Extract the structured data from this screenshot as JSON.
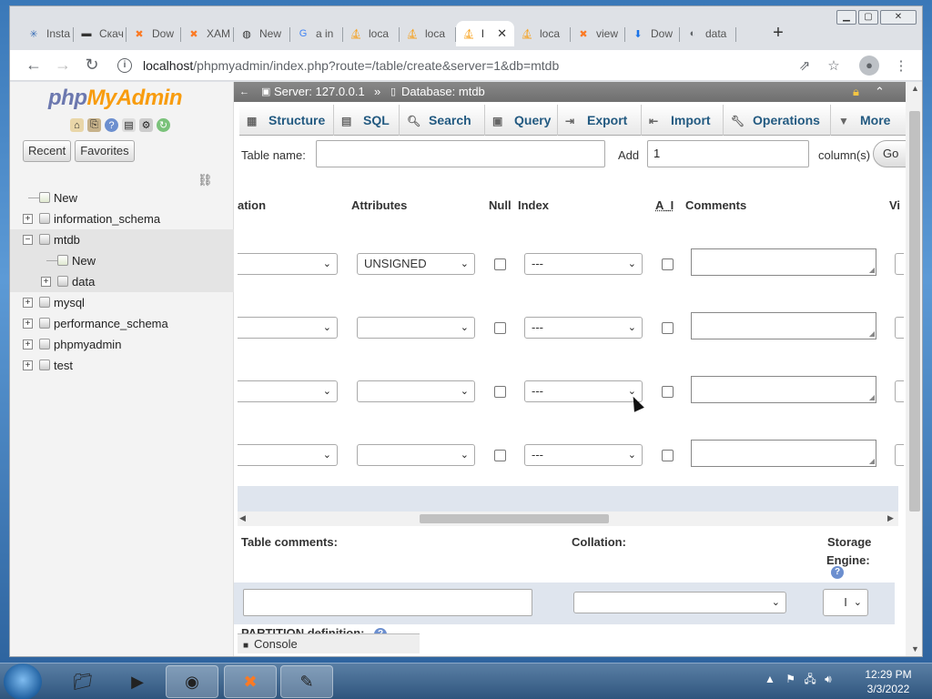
{
  "browser": {
    "tabs": [
      {
        "label": "Insta",
        "icon": "instagram-icon",
        "icon_color": "#3b6fb6"
      },
      {
        "label": "Скач",
        "icon": "terminal-icon",
        "icon_color": "#333333"
      },
      {
        "label": "Dow",
        "icon": "xampp-icon",
        "icon_color": "#fb7a24"
      },
      {
        "label": "XAM",
        "icon": "xampp-icon",
        "icon_color": "#fb7a24"
      },
      {
        "label": "New",
        "icon": "github-icon",
        "icon_color": "#333333"
      },
      {
        "label": "a in",
        "icon": "google-icon",
        "icon_color": "#4285f4"
      },
      {
        "label": "loca",
        "icon": "phpmyadmin-icon",
        "icon_color": "#f89c0e"
      },
      {
        "label": "loca",
        "icon": "phpmyadmin-icon",
        "icon_color": "#f89c0e"
      },
      {
        "label": "l",
        "icon": "phpmyadmin-icon",
        "icon_color": "#f89c0e",
        "active": true
      },
      {
        "label": "loca",
        "icon": "phpmyadmin-icon",
        "icon_color": "#f89c0e"
      },
      {
        "label": "view",
        "icon": "xampp-icon",
        "icon_color": "#fb7a24"
      },
      {
        "label": "Dow",
        "icon": "download-icon",
        "icon_color": "#1a73e8"
      },
      {
        "label": "data",
        "icon": "globe-icon",
        "icon_color": "#5f6368"
      }
    ],
    "new_tab": "+",
    "url_host": "localhost",
    "url_path": "/phpmyadmin/index.php?route=/table/create&server=1&db=mtdb"
  },
  "sidebar": {
    "logo_php": "php",
    "logo_my": "MyAdmin",
    "recent": "Recent",
    "favorites": "Favorites",
    "tree": [
      {
        "label": "New",
        "level": 0,
        "expander": ""
      },
      {
        "label": "information_schema",
        "level": 0,
        "expander": "+"
      },
      {
        "label": "mtdb",
        "level": 0,
        "expander": "−",
        "highlight": true
      },
      {
        "label": "New",
        "level": 1,
        "expander": "",
        "highlight": true
      },
      {
        "label": "data",
        "level": 1,
        "expander": "+",
        "highlight": true
      },
      {
        "label": "mysql",
        "level": 0,
        "expander": "+"
      },
      {
        "label": "performance_schema",
        "level": 0,
        "expander": "+"
      },
      {
        "label": "phpmyadmin",
        "level": 0,
        "expander": "+"
      },
      {
        "label": "test",
        "level": 0,
        "expander": "+"
      }
    ]
  },
  "breadcrumb": {
    "server": "Server: 127.0.0.1",
    "sep": "»",
    "database": "Database: mtdb"
  },
  "menu": [
    {
      "label": "Structure",
      "icon": "structure-icon"
    },
    {
      "label": "SQL",
      "icon": "sql-icon"
    },
    {
      "label": "Search",
      "icon": "search-icon"
    },
    {
      "label": "Query",
      "icon": "query-icon"
    },
    {
      "label": "Export",
      "icon": "export-icon"
    },
    {
      "label": "Import",
      "icon": "import-icon"
    },
    {
      "label": "Operations",
      "icon": "wrench-icon"
    },
    {
      "label": "More",
      "icon": "caret-down-icon"
    }
  ],
  "table_form": {
    "table_name_label": "Table name:",
    "table_name_value": "",
    "add_label": "Add",
    "add_value": "1",
    "columns_label": "column(s)",
    "go_label": "Go"
  },
  "columns_header": {
    "collation": "ation",
    "attributes": "Attributes",
    "null": "Null",
    "index": "Index",
    "ai": "A_I",
    "comments": "Comments",
    "virtuality": "Vi"
  },
  "field_rows": [
    {
      "attribute": "UNSIGNED",
      "index": "---"
    },
    {
      "attribute": "",
      "index": "---"
    },
    {
      "attribute": "",
      "index": "---"
    },
    {
      "attribute": "",
      "index": "---"
    }
  ],
  "bottom": {
    "table_comments": "Table comments:",
    "collation": "Collation:",
    "storage_line1": "Storage",
    "storage_line2": "Engine:",
    "engine_value": "I",
    "partition": "PARTITION definition:",
    "console": "Console"
  },
  "taskbar": {
    "time": "12:29 PM",
    "date": "3/3/2022"
  }
}
